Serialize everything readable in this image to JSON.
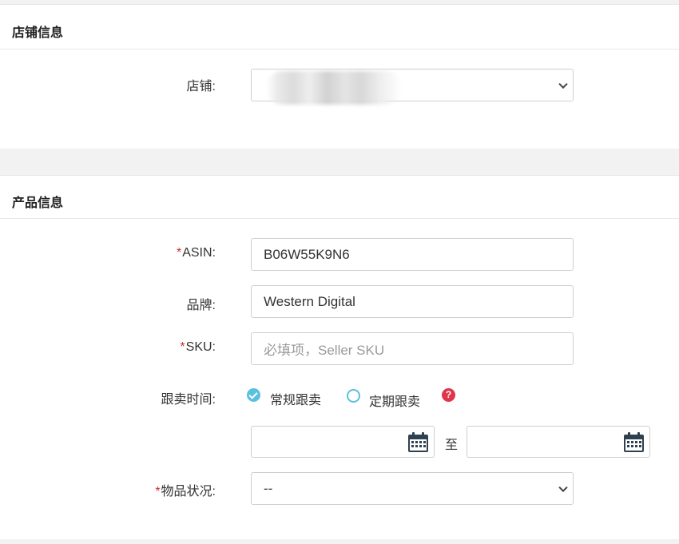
{
  "store_section": {
    "title": "店铺信息",
    "store_label": "店铺:",
    "store_value": ""
  },
  "product_section": {
    "title": "产品信息",
    "asin": {
      "required_mark": "*",
      "label": "ASIN:",
      "value": "B06W55K9N6"
    },
    "brand": {
      "label": "品牌:",
      "value": "Western Digital"
    },
    "sku": {
      "required_mark": "*",
      "label": "SKU:",
      "value": "",
      "placeholder": "必填项，Seller SKU"
    },
    "follow_time": {
      "label": "跟卖时间:",
      "options": [
        {
          "label": "常规跟卖",
          "checked": true
        },
        {
          "label": "定期跟卖",
          "checked": false
        }
      ],
      "help_icon": "?",
      "start_date": "",
      "end_date": "",
      "range_separator": "至"
    },
    "condition": {
      "required_mark": "*",
      "label": "物品状况:",
      "value": "--"
    }
  },
  "icons": {
    "select": "chevron-down-icon",
    "date": "calendar-icon",
    "help": "question-icon"
  },
  "colors": {
    "accent": "#5bc0de",
    "required": "#c9302c",
    "help": "#e0354b"
  }
}
